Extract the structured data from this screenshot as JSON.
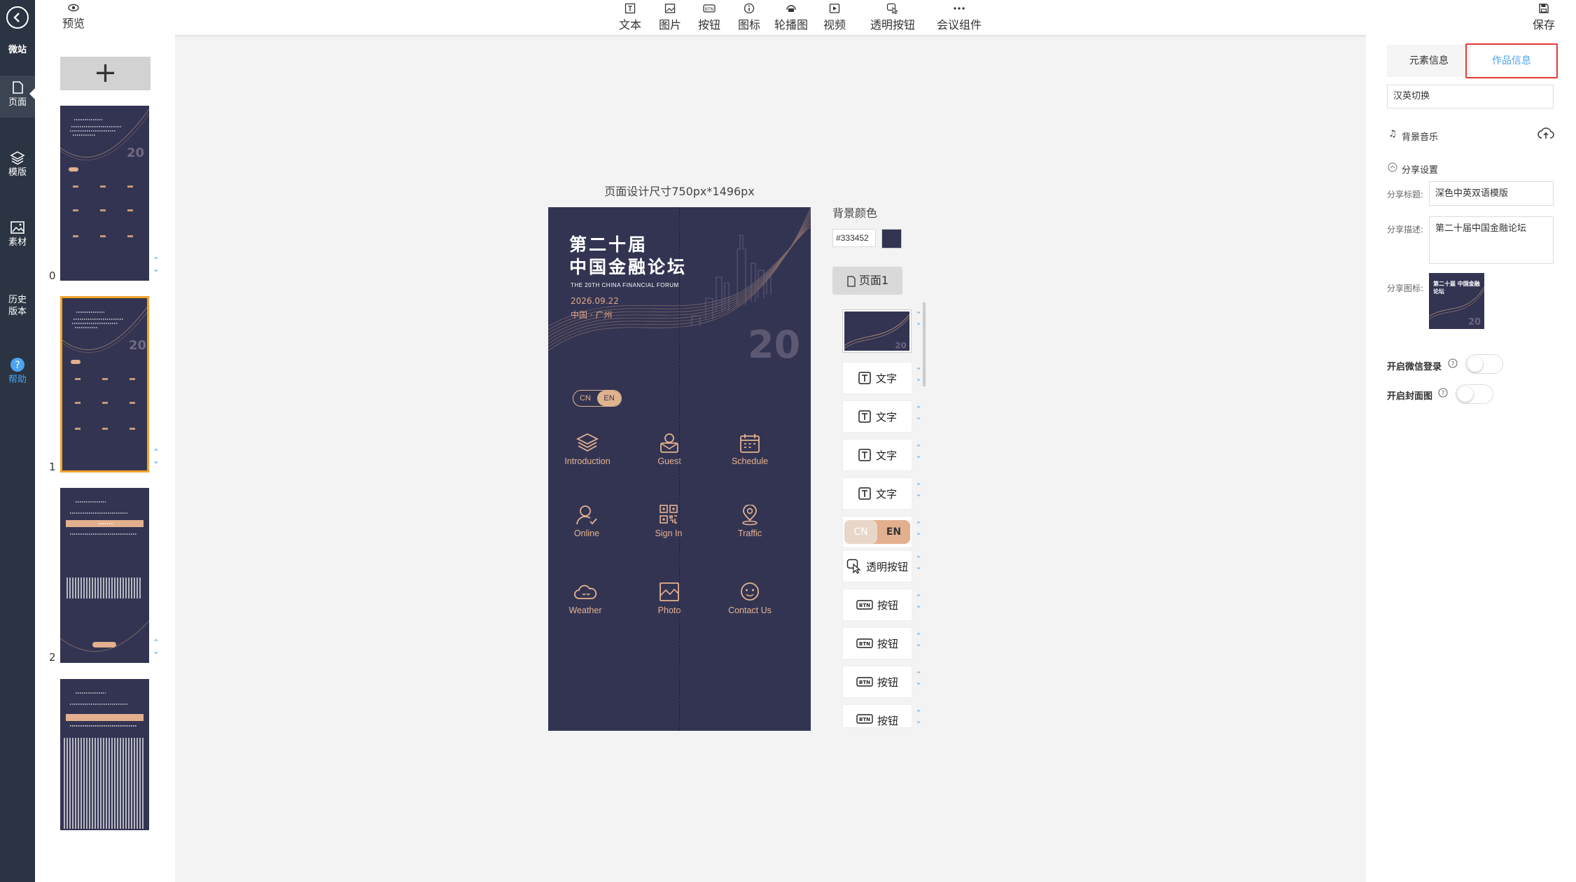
{
  "leftnav": {
    "app": "微站",
    "items": [
      {
        "label": "页面",
        "icon": "page-icon"
      },
      {
        "label": "模版",
        "icon": "layers-icon"
      },
      {
        "label": "素材",
        "icon": "image-icon"
      },
      {
        "label": "历史版本",
        "icon": ""
      },
      {
        "label": "帮助",
        "icon": "help-icon"
      }
    ]
  },
  "toolbar": {
    "preview": "预览",
    "save": "保存",
    "tools": [
      "文本",
      "图片",
      "按钮",
      "图标",
      "轮播图",
      "视频",
      "透明按钮",
      "会议组件"
    ]
  },
  "pages": {
    "add_symbol": "+",
    "numbers": [
      "0",
      "1",
      "2"
    ],
    "selected_index": 1
  },
  "canvas": {
    "size_label": "页面设计尺寸750px*1496px",
    "title_line1": "第二十届",
    "title_line2": "中国金融论坛",
    "subtitle": "THE 20TH CHINA FINANCIAL FORUM",
    "date": "2026.09.22",
    "location": "中国 · 广州",
    "big_number": "20",
    "toggle_cn": "CN",
    "toggle_en": "EN",
    "grid": [
      "Introduction",
      "Guest",
      "Schedule",
      "Online",
      "Sign In",
      "Traffic",
      "Weather",
      "Photo",
      "Contact Us"
    ]
  },
  "background": {
    "label": "背景颜色",
    "value": "#333452",
    "color": "#333452"
  },
  "layers": {
    "page_button": "页面1",
    "items": [
      "文字",
      "文字",
      "文字",
      "文字",
      "CN EN",
      "透明按钮",
      "按钮",
      "按钮",
      "按钮",
      "按钮"
    ]
  },
  "rightpanel": {
    "tab_element": "元素信息",
    "tab_work": "作品信息",
    "lang_switch": "汉英切换",
    "music_label": "背景音乐",
    "share_label": "分享设置",
    "share_title_label": "分享标题:",
    "share_title_value": "深色中英双语模版",
    "share_desc_label": "分享描述:",
    "share_desc_value": "第二十届中国金融论坛",
    "share_icon_label": "分享图标:",
    "share_icon_title": "第二十届 中国金融论坛",
    "wechat_login_label": "开启微信登录",
    "cover_label": "开启封面图",
    "accent": "#4da3f0",
    "highlight": "#e53935"
  }
}
